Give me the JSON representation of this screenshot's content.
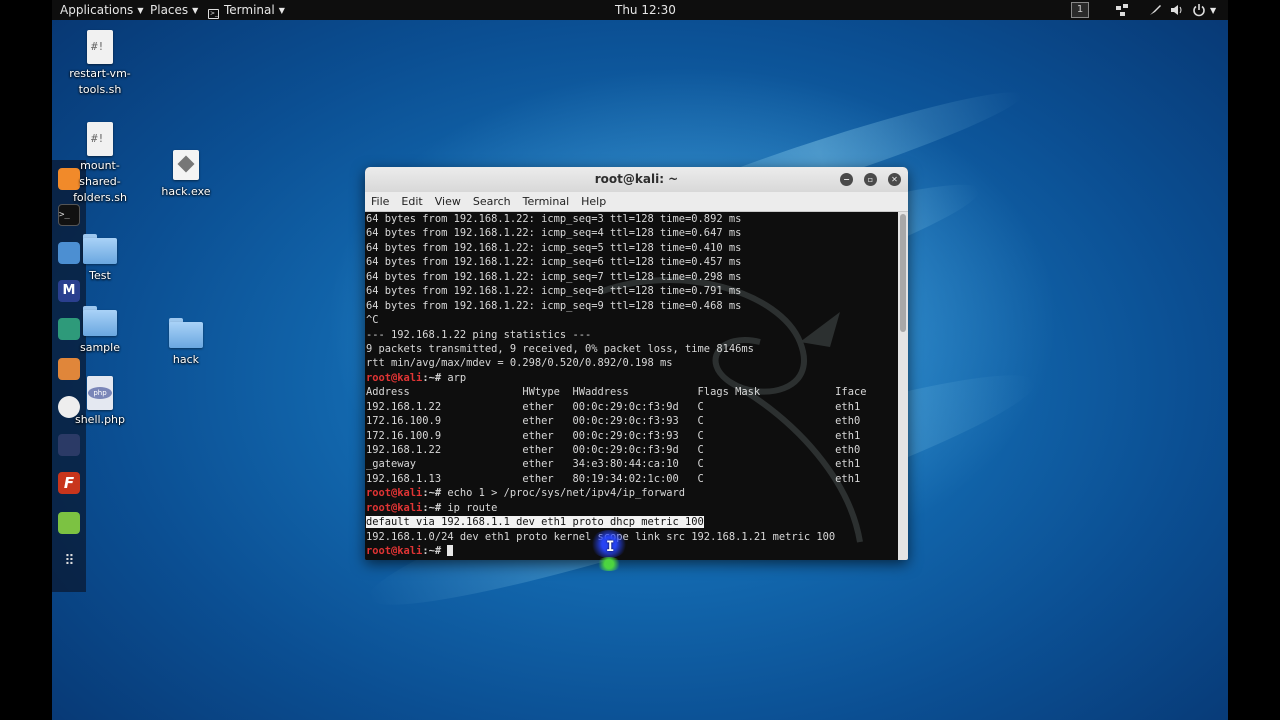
{
  "top_panel": {
    "applications": "Applications",
    "places": "Places",
    "terminal": "Terminal",
    "clock": "Thu 12:30",
    "workspace": "1"
  },
  "desktop_icons": [
    {
      "label": "restart-vm-\ntools.sh",
      "glyph": "#!"
    },
    {
      "label": "mount-\nshared-\nfolders.sh",
      "glyph": "#!"
    },
    {
      "label": "hack.exe"
    },
    {
      "label": "Test"
    },
    {
      "label": "sample"
    },
    {
      "label": "hack"
    },
    {
      "label": "shell.php",
      "glyph": "php"
    }
  ],
  "window": {
    "title": "root@kali: ~",
    "menu": [
      "File",
      "Edit",
      "View",
      "Search",
      "Terminal",
      "Help"
    ]
  },
  "terminal_lines": [
    "64 bytes from 192.168.1.22: icmp_seq=3 ttl=128 time=0.892 ms",
    "64 bytes from 192.168.1.22: icmp_seq=4 ttl=128 time=0.647 ms",
    "64 bytes from 192.168.1.22: icmp_seq=5 ttl=128 time=0.410 ms",
    "64 bytes from 192.168.1.22: icmp_seq=6 ttl=128 time=0.457 ms",
    "64 bytes from 192.168.1.22: icmp_seq=7 ttl=128 time=0.298 ms",
    "64 bytes from 192.168.1.22: icmp_seq=8 ttl=128 time=0.791 ms",
    "64 bytes from 192.168.1.22: icmp_seq=9 ttl=128 time=0.468 ms",
    "^C",
    "--- 192.168.1.22 ping statistics ---",
    "9 packets transmitted, 9 received, 0% packet loss, time 8146ms",
    "rtt min/avg/max/mdev = 0.298/0.520/0.892/0.198 ms"
  ],
  "prompt_user": "root@kali",
  "prompt_path": ":~# ",
  "cmd_arp": "arp",
  "arp_header": "Address                  HWtype  HWaddress           Flags Mask            Iface",
  "arp_rows": [
    "192.168.1.22             ether   00:0c:29:0c:f3:9d   C                     eth1",
    "172.16.100.9             ether   00:0c:29:0c:f3:93   C                     eth0",
    "172.16.100.9             ether   00:0c:29:0c:f3:93   C                     eth1",
    "192.168.1.22             ether   00:0c:29:0c:f3:9d   C                     eth0",
    "_gateway                 ether   34:e3:80:44:ca:10   C                     eth1",
    "192.168.1.13             ether   80:19:34:02:1c:00   C                     eth1"
  ],
  "cmd_echo": "echo 1 > /proc/sys/net/ipv4/ip_forward",
  "cmd_route": "ip route",
  "route_default": "default via 192.168.1.1 dev eth1 proto dhcp metric 100",
  "route_subnet": "192.168.1.0/24 dev eth1 proto kernel scope link src 192.168.1.21 metric 100",
  "colors": {
    "prompt": "#e03434",
    "terminal_bg": "#0e0e0e",
    "desktop": "#1b86cf"
  }
}
